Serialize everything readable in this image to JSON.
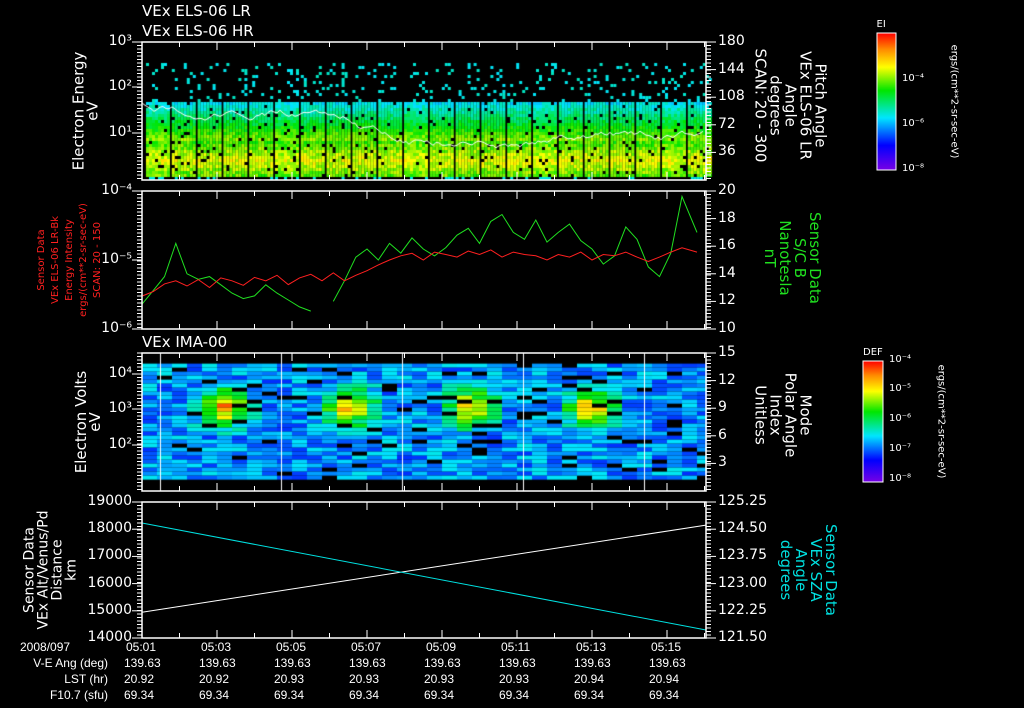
{
  "chart_data": [
    {
      "type": "heatmap",
      "title": [
        "VEx ELS-06 LR",
        "VEx ELS-06 HR"
      ],
      "ylabel": [
        "Electron Energy",
        "eV"
      ],
      "yscale": "log",
      "ylim": [
        1,
        1000
      ],
      "yticks": [
        "10^3",
        "10^2",
        "10^1"
      ],
      "y2label": [
        "Pitch Angle",
        "VEx ELS-06 LR",
        "Angle",
        "degrees",
        "SCAN: 20 - 300"
      ],
      "y2lim": [
        0,
        180
      ],
      "y2ticks": [
        "180",
        "144",
        "108",
        "72",
        "36"
      ],
      "colorbar": {
        "label": "EI",
        "ticks": [
          "10^-4",
          "10^-6",
          "10^-8"
        ],
        "units": "ergs/(cm**2-sr-sec-eV)"
      },
      "overlay_line": "pitch angle (white)"
    },
    {
      "type": "line",
      "ylabel": [
        "Sensor Data",
        "VEx ELS-06 LR-Bk",
        "Energy Intensity",
        "ergs/(cm**2-sr-sec-eV)",
        "SCAN: 20 - 150"
      ],
      "yscale": "log",
      "ylim": [
        1e-06,
        0.0001
      ],
      "yticks": [
        "10^-4",
        "10^-5",
        "10^-6"
      ],
      "y2label": [
        "Sensor Data",
        "S/C B",
        "Nanotesla",
        "nT"
      ],
      "y2lim": [
        10,
        20
      ],
      "y2ticks": [
        "20",
        "18",
        "16",
        "14",
        "12",
        "10"
      ],
      "series": [
        {
          "name": "ELS energy intensity",
          "color": "#ff2020",
          "axis": "left",
          "t_minutes": [
            0,
            0.3,
            0.6,
            0.9,
            1.2,
            1.5,
            1.8,
            2.1,
            2.4,
            2.7,
            3,
            3.3,
            3.6,
            3.9,
            4.2,
            4.5,
            4.8,
            5.1,
            5.4,
            5.7,
            6,
            6.3,
            6.6,
            6.9,
            7.2,
            7.5,
            7.8,
            8.1,
            8.4,
            8.7,
            9,
            9.3,
            9.6,
            9.9,
            10.2,
            10.5,
            10.8,
            11.1,
            11.4,
            11.7,
            12,
            12.3,
            12.6,
            12.9,
            13.2,
            13.5,
            13.8,
            14.1,
            14.4,
            14.8
          ],
          "values": [
            3e-06,
            3.5e-06,
            4.5e-06,
            5e-06,
            4.2e-06,
            5.2e-06,
            4e-06,
            5.5e-06,
            5e-06,
            4.3e-06,
            5.6e-06,
            5e-06,
            6e-06,
            4.4e-06,
            5.5e-06,
            6.2e-06,
            5e-06,
            6.5e-06,
            5e-06,
            6e-06,
            7e-06,
            8.5e-06,
            1e-05,
            1.15e-05,
            1.25e-05,
            1e-05,
            1.3e-05,
            1.2e-05,
            1.1e-05,
            1.35e-05,
            1.2e-05,
            1.4e-05,
            1.1e-05,
            1.3e-05,
            1.2e-05,
            1.15e-05,
            1e-05,
            1.2e-05,
            1.1e-05,
            1.3e-05,
            1e-05,
            1.2e-05,
            1.15e-05,
            1.3e-05,
            1.1e-05,
            9.5e-06,
            1.1e-05,
            1.3e-05,
            1.5e-05,
            1.3e-05
          ]
        },
        {
          "name": "S/C B",
          "color": "#20e020",
          "axis": "right",
          "t_minutes": [
            0,
            0.3,
            0.6,
            0.9,
            1.2,
            1.5,
            1.8,
            2.1,
            2.4,
            2.7,
            3,
            3.3,
            3.6,
            3.9,
            4.2,
            4.5,
            4.8,
            5.1,
            5.4,
            5.7,
            6,
            6.3,
            6.6,
            6.9,
            7.2,
            7.5,
            7.8,
            8.1,
            8.4,
            8.7,
            9,
            9.3,
            9.6,
            9.9,
            10.2,
            10.5,
            10.8,
            11.1,
            11.4,
            11.7,
            12,
            12.3,
            12.6,
            12.9,
            13.2,
            13.5,
            13.8,
            14.1,
            14.4,
            14.8
          ],
          "values": [
            11.8,
            12.8,
            13.8,
            16.2,
            14,
            13.6,
            13.8,
            13.2,
            12.6,
            12.2,
            12.4,
            13.2,
            12.6,
            12.1,
            11.6,
            11.3,
            null,
            12,
            13.5,
            15.2,
            15.8,
            15,
            16.2,
            15.5,
            16.6,
            15.8,
            15.3,
            15.9,
            16.8,
            17.3,
            16.2,
            17.8,
            18.3,
            17,
            16.5,
            17.9,
            16.3,
            17,
            17.6,
            16.4,
            15.8,
            14.7,
            15.3,
            17.4,
            16.5,
            14.5,
            13.8,
            15.5,
            19.6,
            17
          ]
        }
      ]
    },
    {
      "type": "heatmap",
      "title": "VEx IMA-00",
      "ylabel": [
        "Electron Volts",
        "eV"
      ],
      "yscale": "log",
      "ylim": [
        5,
        40000
      ],
      "yticks": [
        "10^4",
        "10^3",
        "10^2"
      ],
      "y2label": [
        "Mode",
        "Polar Angle",
        "Index",
        "Unitless"
      ],
      "y2lim": [
        0,
        15
      ],
      "y2ticks": [
        "15",
        "12",
        "9",
        "6",
        "3"
      ],
      "colorbar": {
        "label": "DEF",
        "ticks": [
          "10^-4",
          "10^-5",
          "10^-6",
          "10^-7",
          "10^-8"
        ],
        "units": "ergs/(cm**2-sr-sec-eV)"
      },
      "overlay_line": "polar angle index staircase (white)"
    },
    {
      "type": "line",
      "ylabel": [
        "Sensor Data",
        "VEx Alt/Venus/Pd",
        "Distance",
        "km"
      ],
      "ylim": [
        14000,
        19000
      ],
      "yticks": [
        "19000",
        "18000",
        "17000",
        "16000",
        "15000",
        "14000"
      ],
      "y2label": [
        "Sensor Data",
        "VEx SZA",
        "Angle",
        "degrees"
      ],
      "y2lim": [
        121.5,
        125.25
      ],
      "y2ticks": [
        "125.25",
        "124.50",
        "123.75",
        "123.00",
        "122.25",
        "121.50"
      ],
      "series": [
        {
          "name": "VEx Alt",
          "color": "#ffffff",
          "axis": "left",
          "t_minutes": [
            0,
            15.04
          ],
          "values": [
            14950,
            18150
          ]
        },
        {
          "name": "VEx SZA",
          "color": "#00e0e0",
          "axis": "right",
          "t_minutes": [
            0,
            15.04
          ],
          "values": [
            124.67,
            121.72
          ]
        }
      ]
    }
  ],
  "x_axis": {
    "date": "2008/097",
    "times": [
      "05:01",
      "05:03",
      "05:05",
      "05:07",
      "05:09",
      "05:11",
      "05:13",
      "05:15"
    ],
    "rows": [
      {
        "label": "V-E Ang (deg)",
        "values": [
          "139.63",
          "139.63",
          "139.63",
          "139.63",
          "139.63",
          "139.63",
          "139.63",
          "139.63"
        ]
      },
      {
        "label": "LST (hr)",
        "values": [
          "20.92",
          "20.92",
          "20.93",
          "20.93",
          "20.93",
          "20.93",
          "20.94",
          "20.94"
        ]
      },
      {
        "label": "F10.7 (sfu)",
        "values": [
          "69.34",
          "69.34",
          "69.34",
          "69.34",
          "69.34",
          "69.34",
          "69.34",
          "69.34"
        ]
      }
    ]
  }
}
